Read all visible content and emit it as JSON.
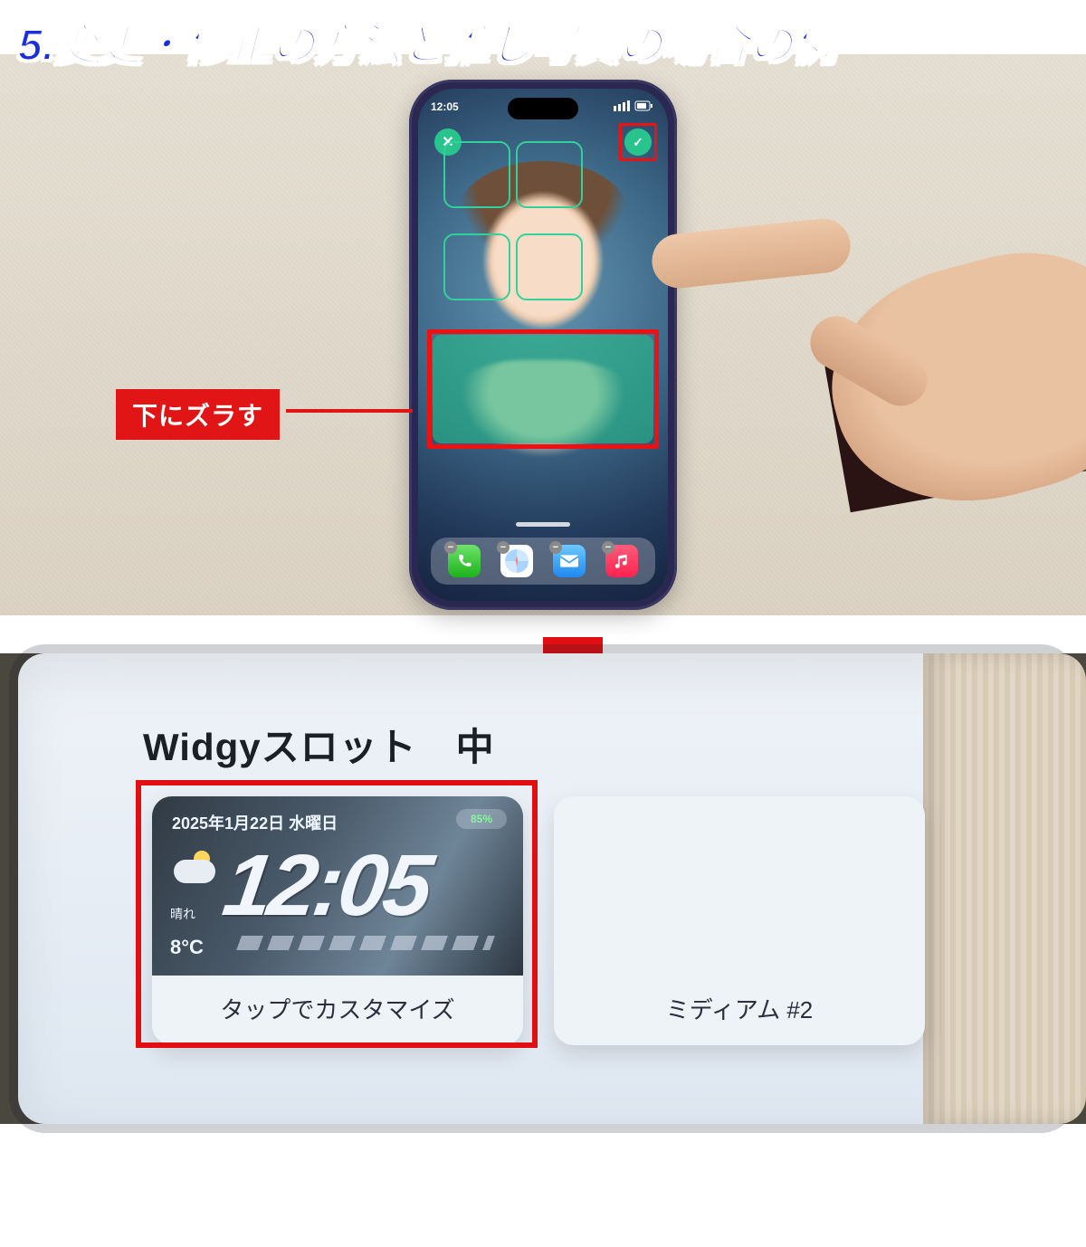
{
  "title": "5.変更・修正の方法と推し写真の場合の例",
  "top": {
    "statusTime": "12:05",
    "closeGlyph": "✕",
    "okGlyph": "✓",
    "dock": {
      "removeGlyph": "−"
    },
    "callout": "下にズラす"
  },
  "bottom": {
    "slotTitle": "Widgyスロット　中",
    "card1": {
      "date": "2025年1月22日 水曜日",
      "battery": "85%",
      "time": "12:05",
      "weatherLabel": "晴れ",
      "temp": "8°C",
      "caption": "タップでカスタマイズ"
    },
    "card2": {
      "caption": "ミディアム #2"
    }
  }
}
